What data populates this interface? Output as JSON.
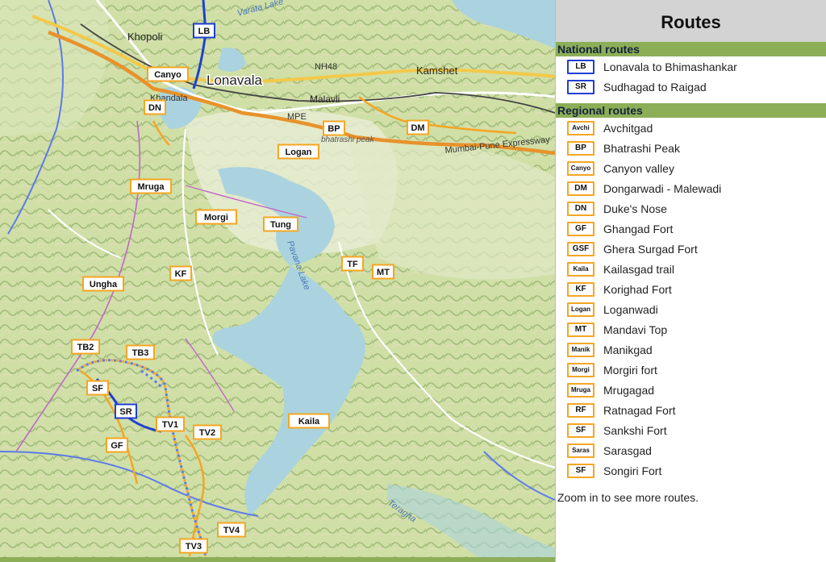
{
  "panel": {
    "title": "Routes",
    "national_heading": "National routes",
    "regional_heading": "Regional routes",
    "note": "Zoom in to see more routes.",
    "national_routes": [
      {
        "code": "LB",
        "name": "Lonavala to Bhimashankar"
      },
      {
        "code": "SR",
        "name": "Sudhagad to Raigad"
      }
    ],
    "regional_routes": [
      {
        "code": "Avchi",
        "name": "Avchitgad"
      },
      {
        "code": "BP",
        "name": "Bhatrashi Peak"
      },
      {
        "code": "Canyo",
        "name": "Canyon valley"
      },
      {
        "code": "DM",
        "name": "Dongarwadi - Malewadi"
      },
      {
        "code": "DN",
        "name": "Duke's Nose"
      },
      {
        "code": "GF",
        "name": "Ghangad Fort"
      },
      {
        "code": "GSF",
        "name": "Ghera Surgad Fort"
      },
      {
        "code": "Kaila",
        "name": "Kailasgad trail"
      },
      {
        "code": "KF",
        "name": "Korighad Fort"
      },
      {
        "code": "Logan",
        "name": "Loganwadi"
      },
      {
        "code": "MT",
        "name": "Mandavi Top"
      },
      {
        "code": "Manik",
        "name": "Manikgad"
      },
      {
        "code": "Morgi",
        "name": "Morgiri fort"
      },
      {
        "code": "Mruga",
        "name": "Mrugagad"
      },
      {
        "code": "RF",
        "name": "Ratnagad Fort"
      },
      {
        "code": "SF",
        "name": "Sankshi Fort"
      },
      {
        "code": "Saras",
        "name": "Sarasgad"
      },
      {
        "code": "SF",
        "name": "Songiri Fort"
      }
    ]
  },
  "map": {
    "places": [
      "Khopoli",
      "Lonavala",
      "Khandala",
      "Kamshet",
      "Malavli",
      "bhatrashi peak"
    ],
    "roads": [
      "NH48",
      "MPE",
      "Mumbai-Pune Expressway"
    ],
    "water": [
      "Pavana Lake",
      "Varata Lake",
      "Teragha"
    ],
    "route_badges": [
      {
        "code": "LB",
        "kind": "national"
      },
      {
        "code": "SR",
        "kind": "national"
      },
      {
        "code": "Canyo",
        "kind": "regional"
      },
      {
        "code": "DN",
        "kind": "regional"
      },
      {
        "code": "BP",
        "kind": "regional"
      },
      {
        "code": "DM",
        "kind": "regional"
      },
      {
        "code": "Logan",
        "kind": "regional"
      },
      {
        "code": "Mruga",
        "kind": "regional"
      },
      {
        "code": "Morgi",
        "kind": "regional"
      },
      {
        "code": "Tung",
        "kind": "regional"
      },
      {
        "code": "TF",
        "kind": "regional"
      },
      {
        "code": "MT",
        "kind": "regional"
      },
      {
        "code": "KF",
        "kind": "regional"
      },
      {
        "code": "Ungha",
        "kind": "regional"
      },
      {
        "code": "TB2",
        "kind": "regional"
      },
      {
        "code": "TB3",
        "kind": "regional"
      },
      {
        "code": "SF",
        "kind": "regional"
      },
      {
        "code": "GF",
        "kind": "regional"
      },
      {
        "code": "TV1",
        "kind": "regional"
      },
      {
        "code": "TV2",
        "kind": "regional"
      },
      {
        "code": "Kaila",
        "kind": "regional"
      },
      {
        "code": "TV4",
        "kind": "regional"
      },
      {
        "code": "TV3",
        "kind": "regional"
      }
    ],
    "colors": {
      "national": "#1f3fd1",
      "regional": "#f5a623",
      "water": "#aad3df",
      "terrain": "#c8d9a0"
    }
  }
}
